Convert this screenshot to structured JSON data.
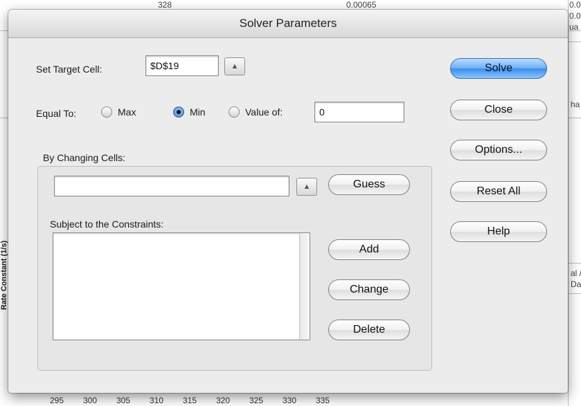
{
  "background": {
    "top_fragments": [
      "328",
      "0.00065",
      "0.0",
      "0.0",
      "ua"
    ],
    "right_fragments": [
      "ha",
      "al /",
      "Dat"
    ],
    "y_axis_label": "Rate Constant (1/s)",
    "x_ticks": [
      "295",
      "300",
      "305",
      "310",
      "315",
      "320",
      "325",
      "330",
      "335"
    ]
  },
  "dialog": {
    "title": "Solver Parameters",
    "target_label": "Set Target Cell:",
    "target_value": "$D$19",
    "equal_to_label": "Equal To:",
    "radio_max": "Max",
    "radio_min": "Min",
    "radio_value_of": "Value of:",
    "value_of_value": "0",
    "selected_option": "Min",
    "changing_cells_label": "By Changing Cells:",
    "changing_cells_value": "",
    "constraints_label": "Subject to the Constraints:",
    "constraints": []
  },
  "buttons": {
    "solve": "Solve",
    "close": "Close",
    "options": "Options...",
    "reset_all": "Reset All",
    "help": "Help",
    "guess": "Guess",
    "add": "Add",
    "change": "Change",
    "delete": "Delete"
  },
  "icons": {
    "collapse": "collapse-dialog-icon"
  },
  "colors": {
    "default_button": "#5ea4ef",
    "dialog_bg": "#ececec"
  }
}
